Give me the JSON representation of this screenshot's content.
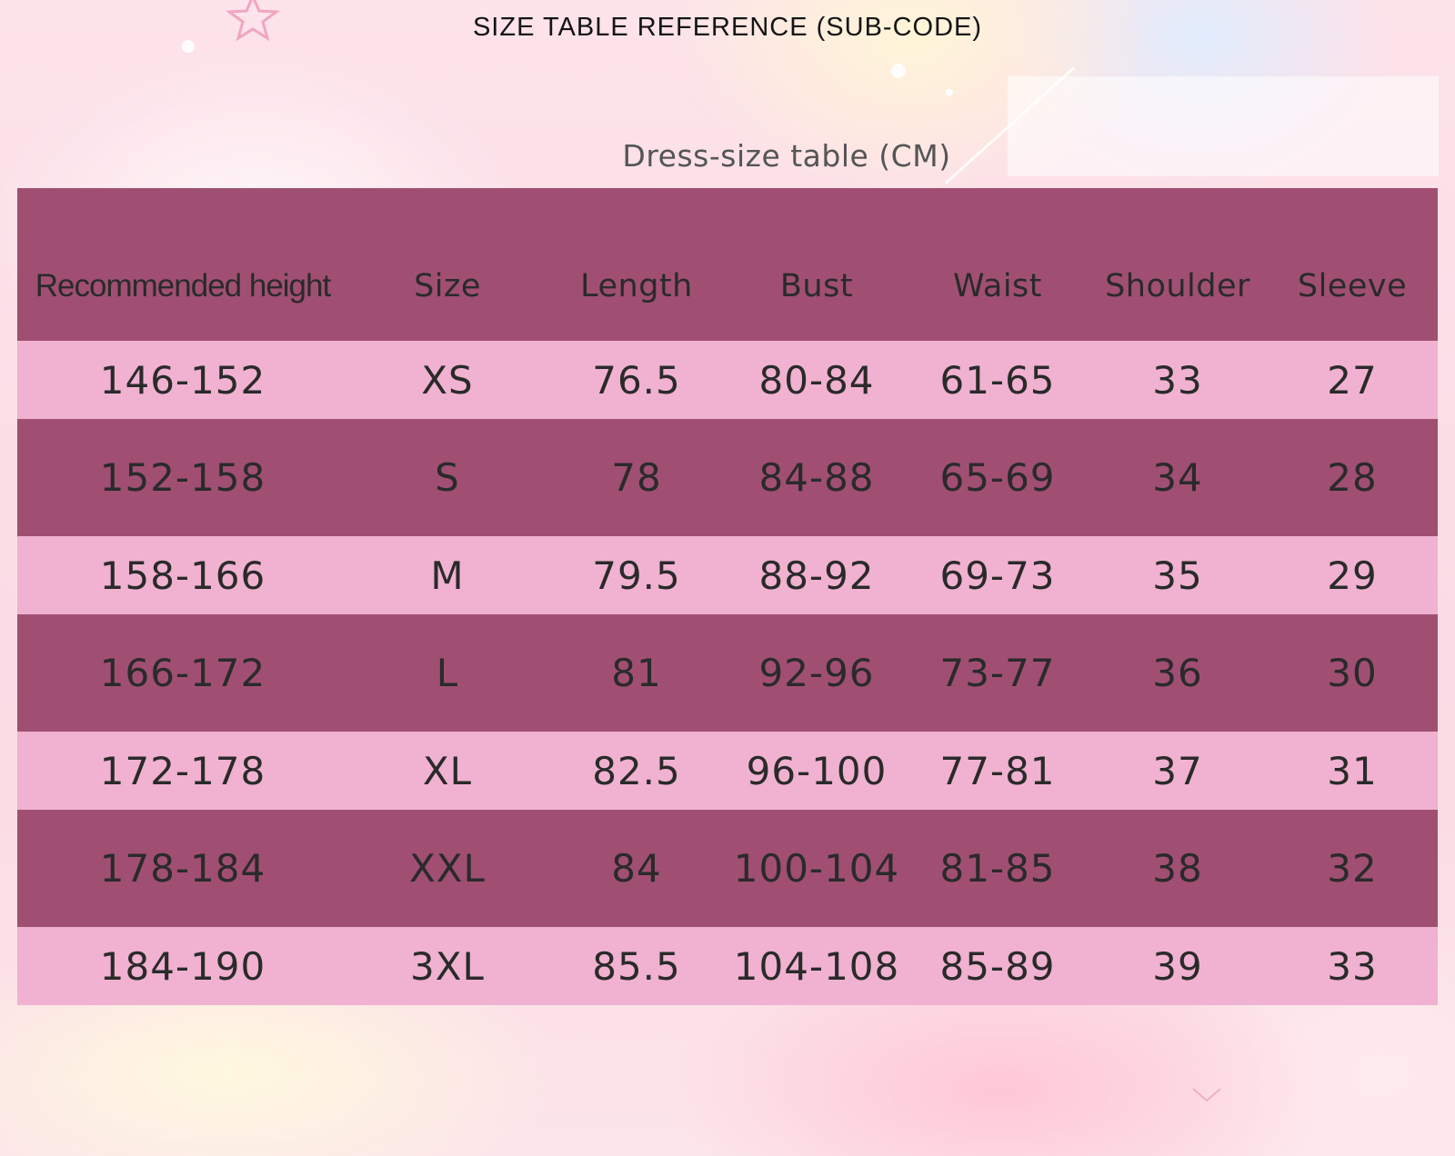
{
  "page": {
    "title": "SIZE TABLE REFERENCE (SUB-CODE)",
    "subtitle": "Dress-size table (CM)"
  },
  "table": {
    "headers": [
      "Recommended height",
      "Size",
      "Length",
      "Bust",
      "Waist",
      "Shoulder",
      "Sleeve"
    ],
    "rows": [
      [
        "146-152",
        "XS",
        "76.5",
        "80-84",
        "61-65",
        "33",
        "27"
      ],
      [
        "152-158",
        "S",
        "78",
        "84-88",
        "65-69",
        "34",
        "28"
      ],
      [
        "158-166",
        "M",
        "79.5",
        "88-92",
        "69-73",
        "35",
        "29"
      ],
      [
        "166-172",
        "L",
        "81",
        "92-96",
        "73-77",
        "36",
        "30"
      ],
      [
        "172-178",
        "XL",
        "82.5",
        "96-100",
        "77-81",
        "37",
        "31"
      ],
      [
        "178-184",
        "XXL",
        "84",
        "100-104",
        "81-85",
        "38",
        "32"
      ],
      [
        "184-190",
        "3XL",
        "85.5",
        "104-108",
        "85-89",
        "39",
        "33"
      ]
    ]
  },
  "colors": {
    "header_background": "#a04f72",
    "light_row": "#f0b2d0",
    "dark_row": "#a04f72",
    "text": "#2a2a2a",
    "page_background": "#fde3ea"
  },
  "decorations": {
    "star_icon": "star-outline-icon"
  }
}
